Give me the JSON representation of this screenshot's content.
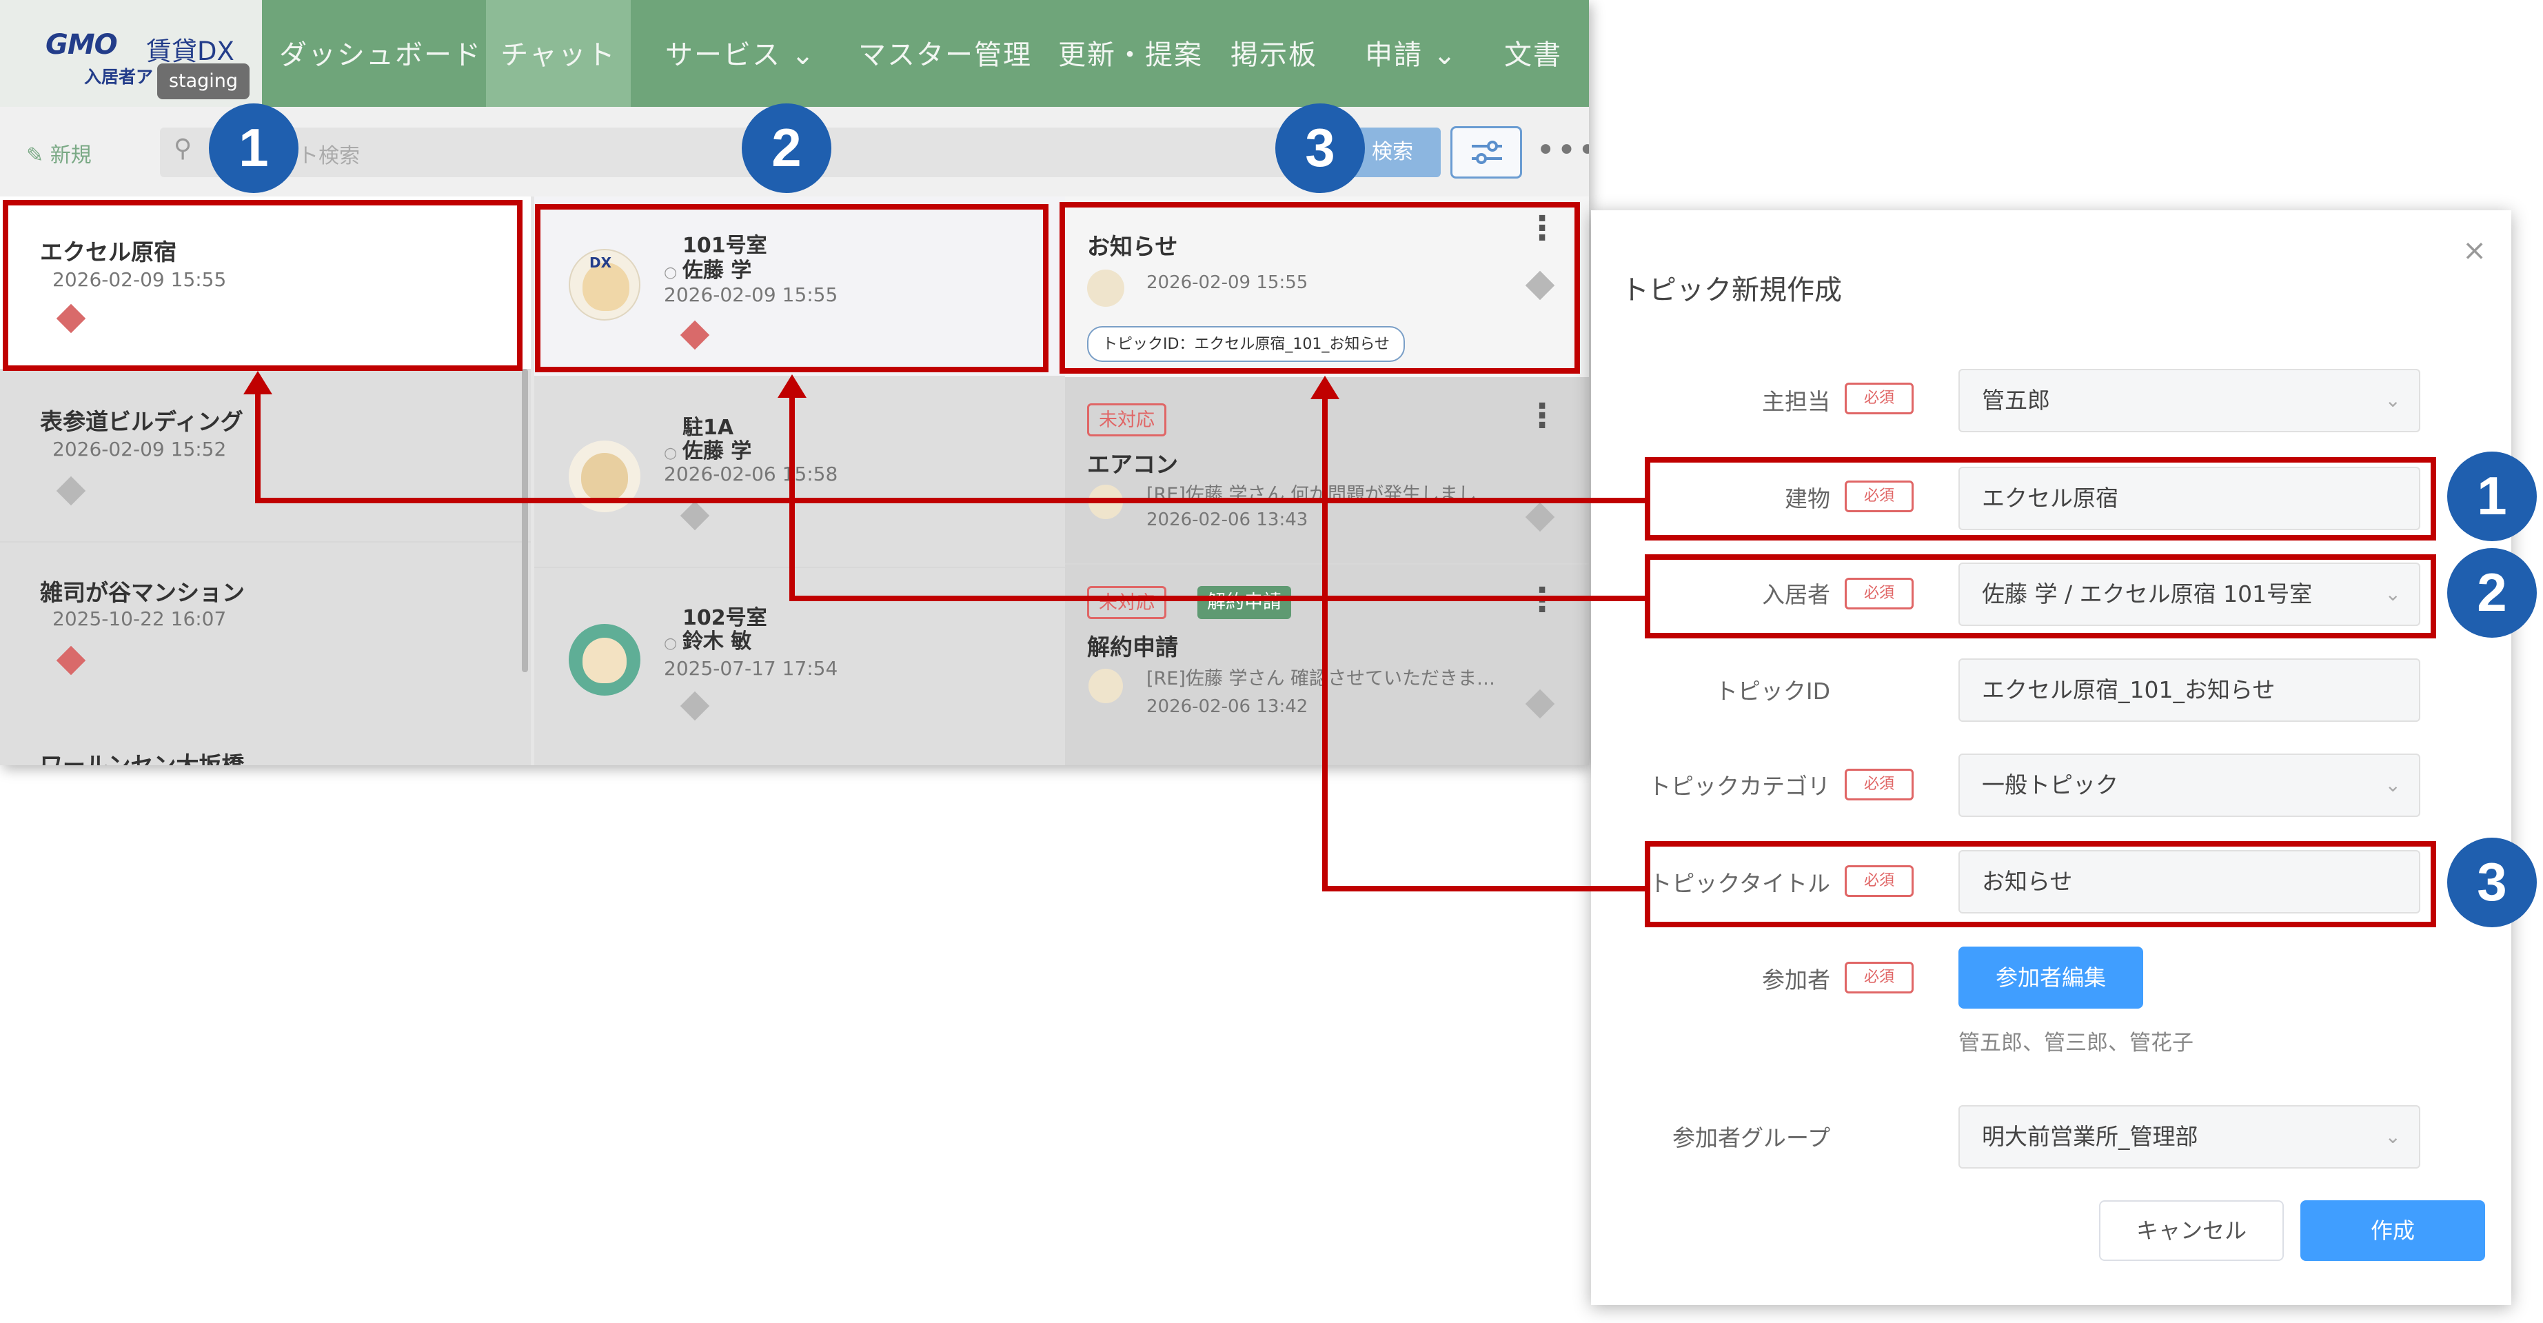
{
  "app": {
    "logo": {
      "brand": "GMO",
      "product": "賃貸DX",
      "sub": "入居者ア",
      "env": "staging"
    },
    "nav": [
      {
        "label": "ダッシュボード"
      },
      {
        "label": "チャット"
      },
      {
        "label": "サービス ⌄"
      },
      {
        "label": "マスター管理"
      },
      {
        "label": "更新・提案"
      },
      {
        "label": "掲示板"
      },
      {
        "label": "申請 ⌄"
      },
      {
        "label": "文書"
      }
    ],
    "toolbar": {
      "new_label": "新規",
      "search_placeholder": "ト検索",
      "search_button": "検索",
      "more": "•••"
    },
    "buildings": [
      {
        "name": "エクセル原宿",
        "date": "2026-02-09 15:55"
      },
      {
        "name": "表参道ビルディング",
        "date": "2026-02-09 15:52"
      },
      {
        "name": "雑司が谷マンション",
        "date": "2025-10-22 16:07"
      },
      {
        "name": "ワールンセン大坂橋",
        "date": ""
      }
    ],
    "residents": [
      {
        "room": "101号室",
        "name": "佐藤 学",
        "date": "2026-02-09 15:55"
      },
      {
        "room": "駐1A",
        "name": "佐藤 学",
        "date": "2026-02-06 15:58"
      },
      {
        "room": "102号室",
        "name": "鈴木 敏",
        "date": "2025-07-17 17:54"
      }
    ],
    "topics": [
      {
        "title": "お知らせ",
        "date": "2026-02-09 15:55",
        "chip": "トピックID：エクセル原宿_101_お知らせ"
      },
      {
        "badges": [
          "未対応"
        ],
        "title": "エアコン",
        "preview": "[RE]佐藤 学さん 何か問題が発生しまし…",
        "date": "2026-02-06 13:43"
      },
      {
        "badges": [
          "未対応",
          "解約申請"
        ],
        "title": "解約申請",
        "preview": "[RE]佐藤 学さん 確認させていただきま…",
        "date": "2026-02-06 13:42"
      }
    ]
  },
  "dialog": {
    "title": "トピック新規作成",
    "close": "×",
    "required": "必須",
    "fields": [
      {
        "label": "主担当",
        "value": "管五郎"
      },
      {
        "label": "建物",
        "value": "エクセル原宿"
      },
      {
        "label": "入居者",
        "value": "佐藤 学 / エクセル原宿 101号室"
      },
      {
        "label": "トピックID",
        "value": "エクセル原宿_101_お知らせ"
      },
      {
        "label": "トピックカテゴリ",
        "value": "一般トピック"
      },
      {
        "label": "トピックタイトル",
        "value": "お知らせ"
      },
      {
        "label": "参加者",
        "button": "参加者編集",
        "names": "管五郎、管三郎、管花子"
      },
      {
        "label": "参加者グループ",
        "value": "明大前営業所_管理部"
      }
    ],
    "cancel": "キャンセル",
    "create": "作成"
  },
  "markers": [
    "1",
    "2",
    "3"
  ],
  "colors": {
    "nav": "#6fa57a",
    "highlight": "#c00000",
    "marker": "#1f5faf",
    "primary": "#409eff"
  }
}
